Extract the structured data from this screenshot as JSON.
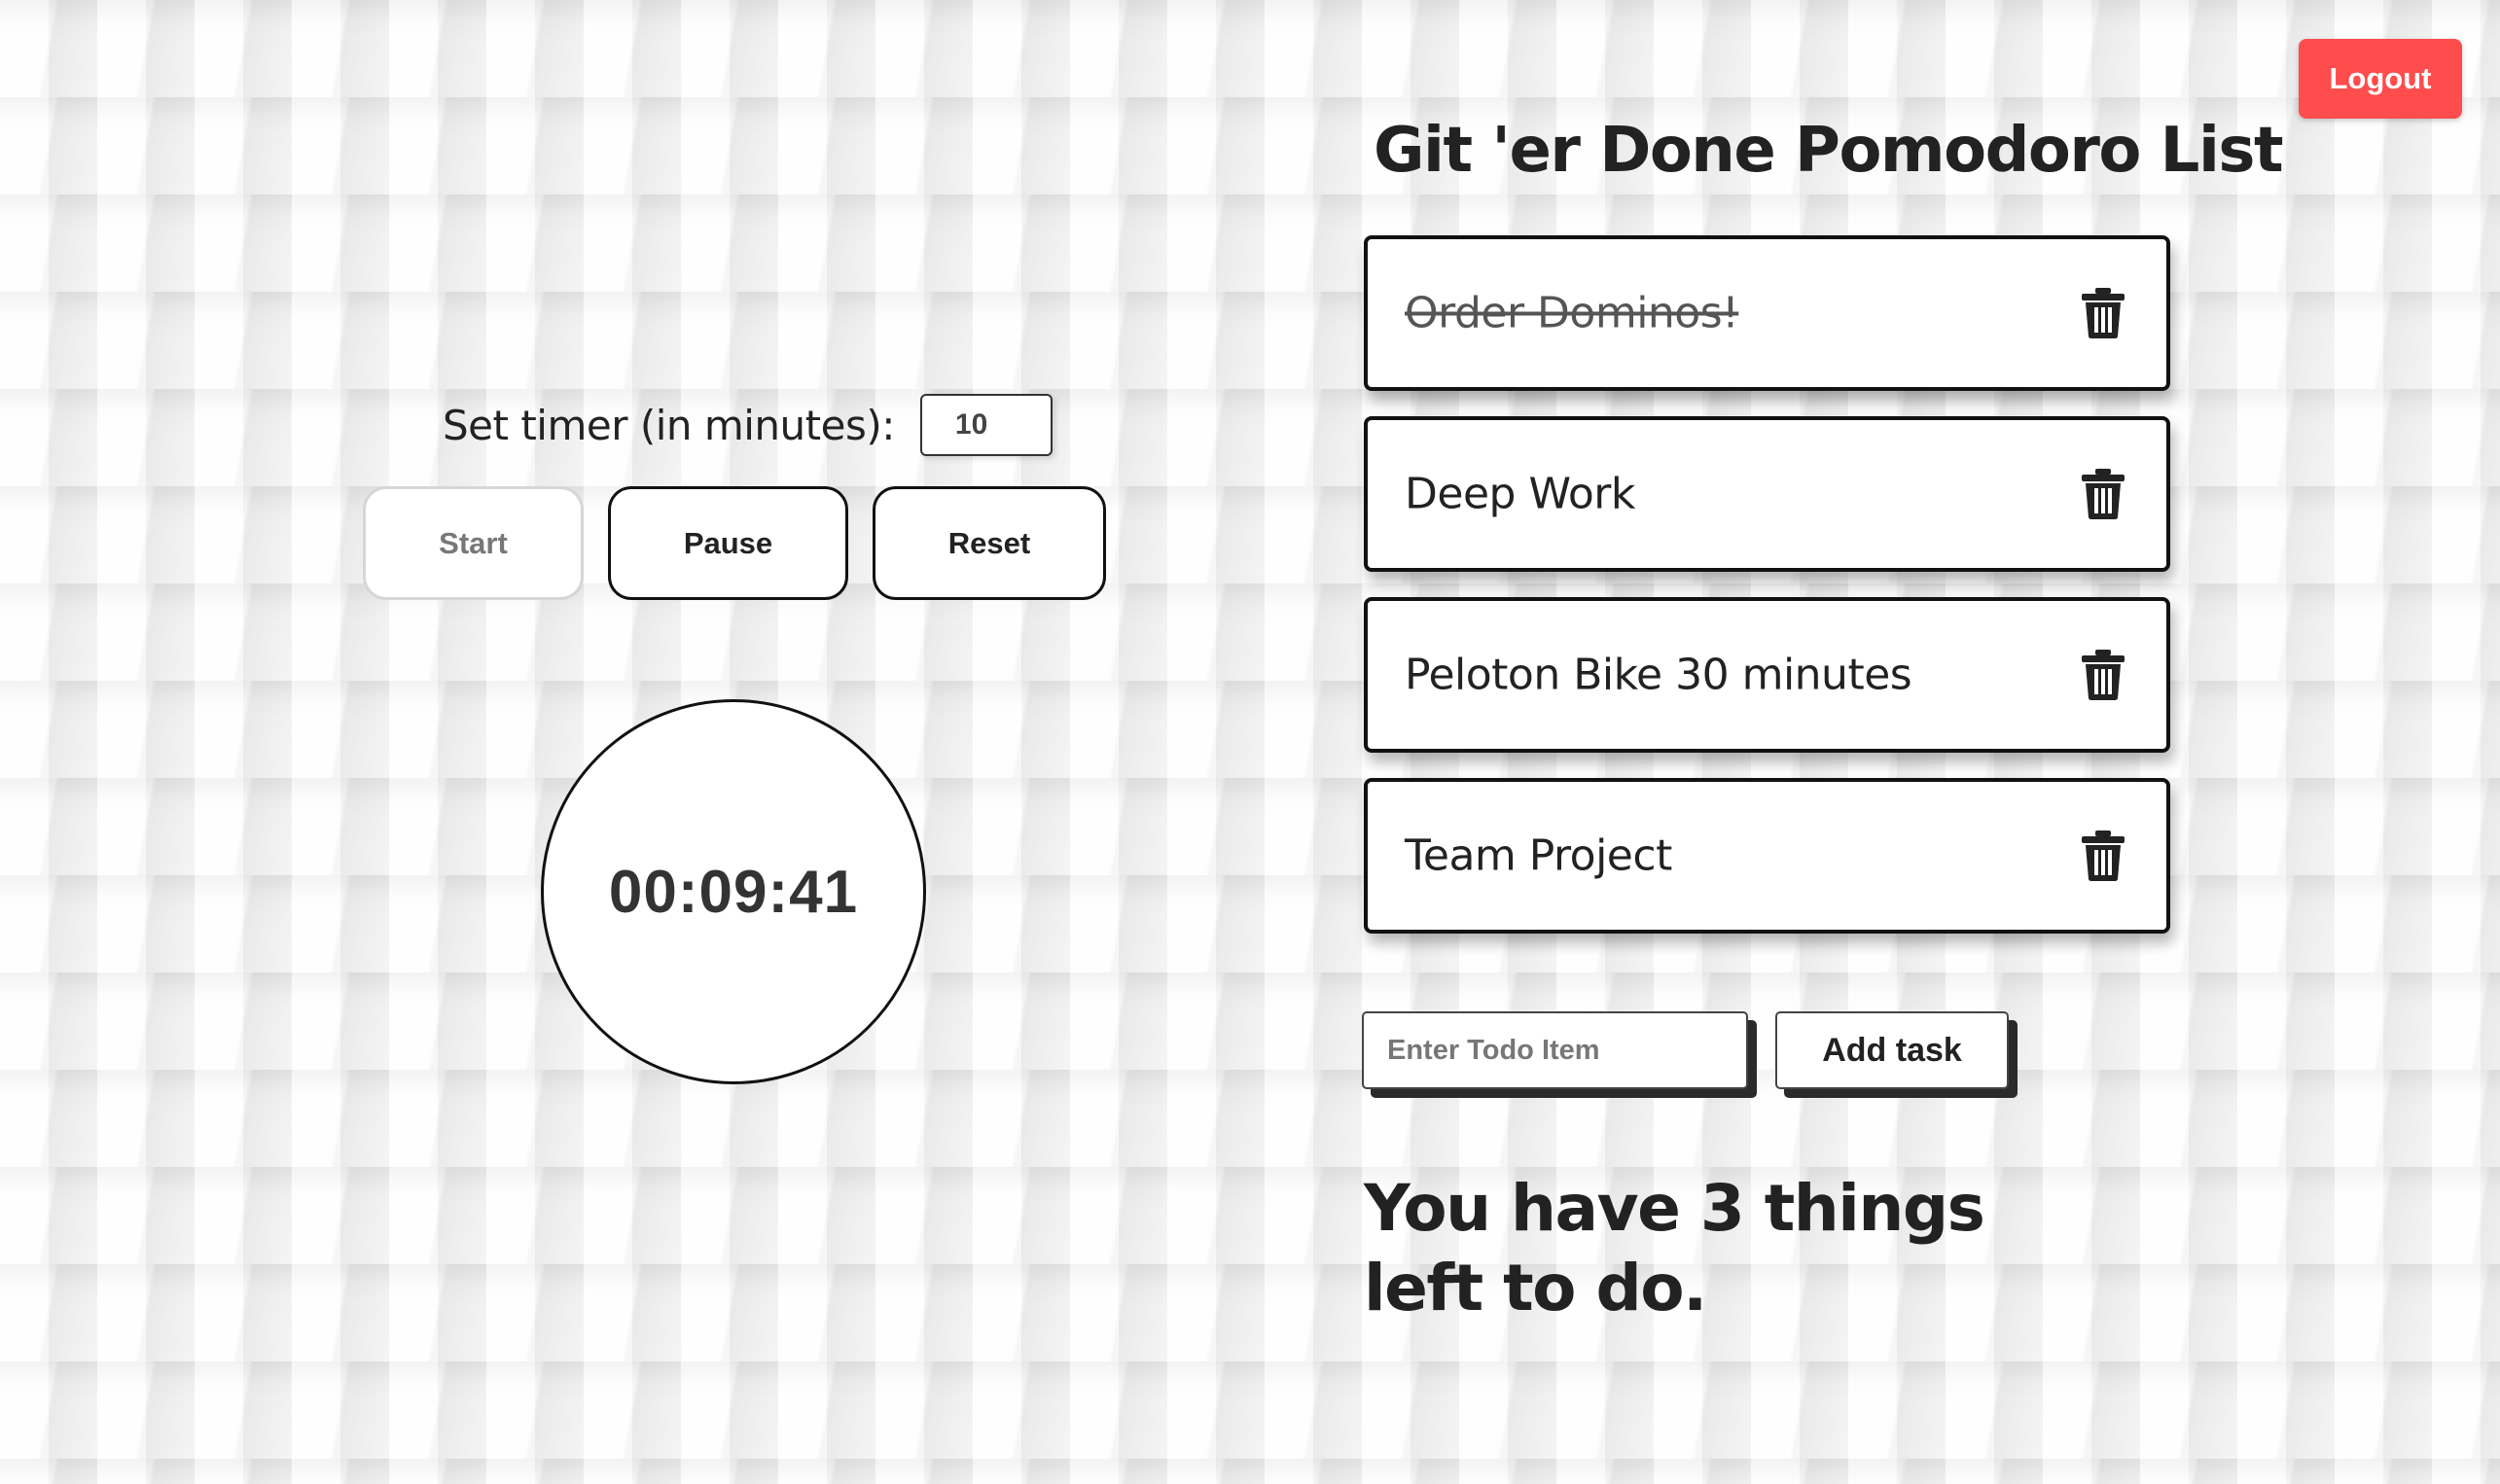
{
  "header": {
    "logout_label": "Logout"
  },
  "timer": {
    "set_label": "Set timer (in minutes):",
    "minutes_value": "10",
    "start_label": "Start",
    "pause_label": "Pause",
    "reset_label": "Reset",
    "display": "00:09:41"
  },
  "todo": {
    "title": "Git 'er Done Pomodoro List",
    "items": [
      {
        "text": "Order Dominos!",
        "completed": true
      },
      {
        "text": "Deep Work",
        "completed": false
      },
      {
        "text": "Peloton Bike 30 minutes",
        "completed": false
      },
      {
        "text": "Team Project",
        "completed": false
      }
    ],
    "input_placeholder": "Enter Todo Item",
    "add_label": "Add task",
    "remaining_text": "You have 3 things left to do."
  },
  "colors": {
    "logout_bg": "#ff4c4c",
    "border": "#111111",
    "text": "#222222"
  },
  "icons": {
    "delete": "trash-icon"
  }
}
